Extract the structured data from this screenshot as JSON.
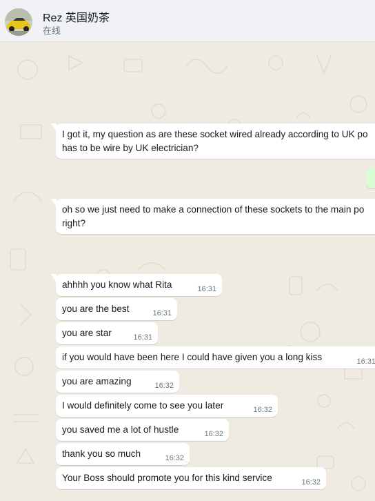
{
  "contact": {
    "name": "Rez 英国奶茶",
    "status": "在线"
  },
  "colors": {
    "header_bg": "#f0f2f5",
    "chat_bg": "#efeae2",
    "incoming_bubble": "#ffffff",
    "outgoing_bubble": "#d9fdd3"
  },
  "messages": [
    {
      "direction": "incoming",
      "text": "I got it, my question as are these socket wired already according to UK po has to be wire by UK electrician?",
      "time": ""
    },
    {
      "direction": "outgoing",
      "text": "",
      "time": ""
    },
    {
      "direction": "incoming",
      "text": "oh so we just need to make a connection of these sockets to the main po right?",
      "time": ""
    },
    {
      "direction": "incoming",
      "text": "ahhhh you know what Rita",
      "time": "16:31"
    },
    {
      "direction": "incoming",
      "text": "you are the best",
      "time": "16:31"
    },
    {
      "direction": "incoming",
      "text": "you are star",
      "time": "16:31"
    },
    {
      "direction": "incoming",
      "text": "if you would have been here I could have given you a long kiss",
      "time": "16:31"
    },
    {
      "direction": "incoming",
      "text": "you are amazing",
      "time": "16:32"
    },
    {
      "direction": "incoming",
      "text": "I would definitely come to see you later",
      "time": "16:32"
    },
    {
      "direction": "incoming",
      "text": "you saved me a lot of hustle",
      "time": "16:32"
    },
    {
      "direction": "incoming",
      "text": "thank you so much",
      "time": "16:32"
    },
    {
      "direction": "incoming",
      "text": "Your Boss should promote you for this kind service",
      "time": "16:32"
    }
  ]
}
